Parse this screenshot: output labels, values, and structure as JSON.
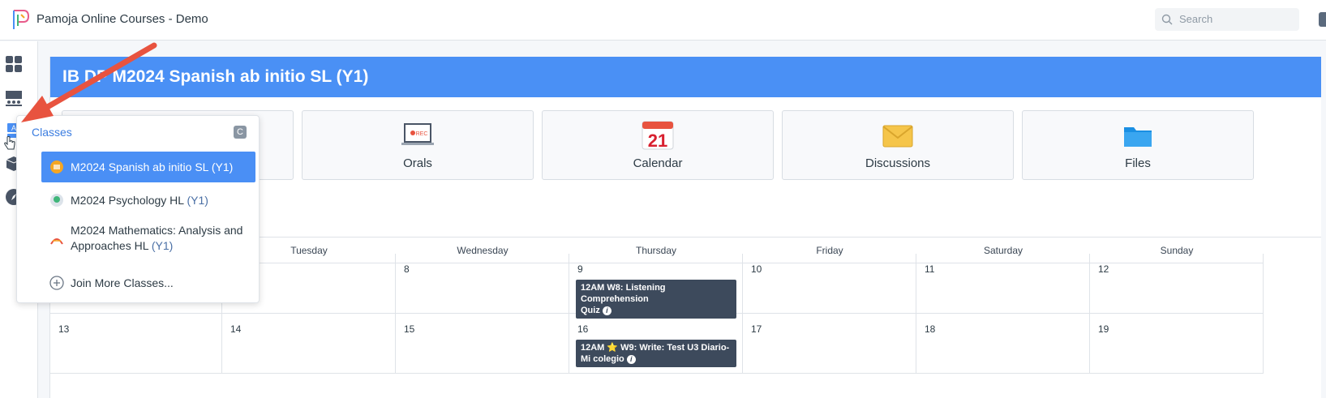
{
  "app": {
    "title": "Pamoja Online Courses - Demo"
  },
  "search": {
    "placeholder": "Search"
  },
  "course": {
    "title": "IB DP M2024 Spanish ab initio SL (Y1)"
  },
  "tiles": [
    {
      "label": "",
      "icon": "orals-icon"
    },
    {
      "label": "Orals",
      "icon": "rec-laptop-icon"
    },
    {
      "label": "Calendar",
      "icon": "calendar-icon",
      "number": "21"
    },
    {
      "label": "Discussions",
      "icon": "envelope-icon"
    },
    {
      "label": "Files",
      "icon": "folder-icon"
    }
  ],
  "calendar": {
    "days": [
      "Tuesday",
      "Wednesday",
      "Thursday",
      "Friday",
      "Saturday",
      "Sunday"
    ],
    "week1": [
      "8",
      "9",
      "10",
      "11",
      "12"
    ],
    "week2": [
      "13",
      "14",
      "15",
      "16",
      "17",
      "18",
      "19"
    ],
    "events": [
      {
        "line1": "12AM W8: Listening Comprehension",
        "line2": "Quiz"
      },
      {
        "line1": "12AM ⭐ W9: Write: Test U3 Diario-",
        "line2": "Mi colegio"
      }
    ]
  },
  "classes_menu": {
    "header": "Classes",
    "shortcut": "C",
    "items": [
      {
        "name": "M2024 Spanish ab initio SL",
        "year": "(Y1)"
      },
      {
        "name": "M2024 Psychology HL",
        "year": "(Y1)"
      },
      {
        "name1": "M2024 Mathematics: Analysis and",
        "name2": "Approaches HL",
        "year": "(Y1)"
      }
    ],
    "join": "Join More Classes..."
  },
  "colors": {
    "accent": "#4a90f5",
    "event_bg": "#3d4a5c",
    "arrow": "#e8533f"
  }
}
